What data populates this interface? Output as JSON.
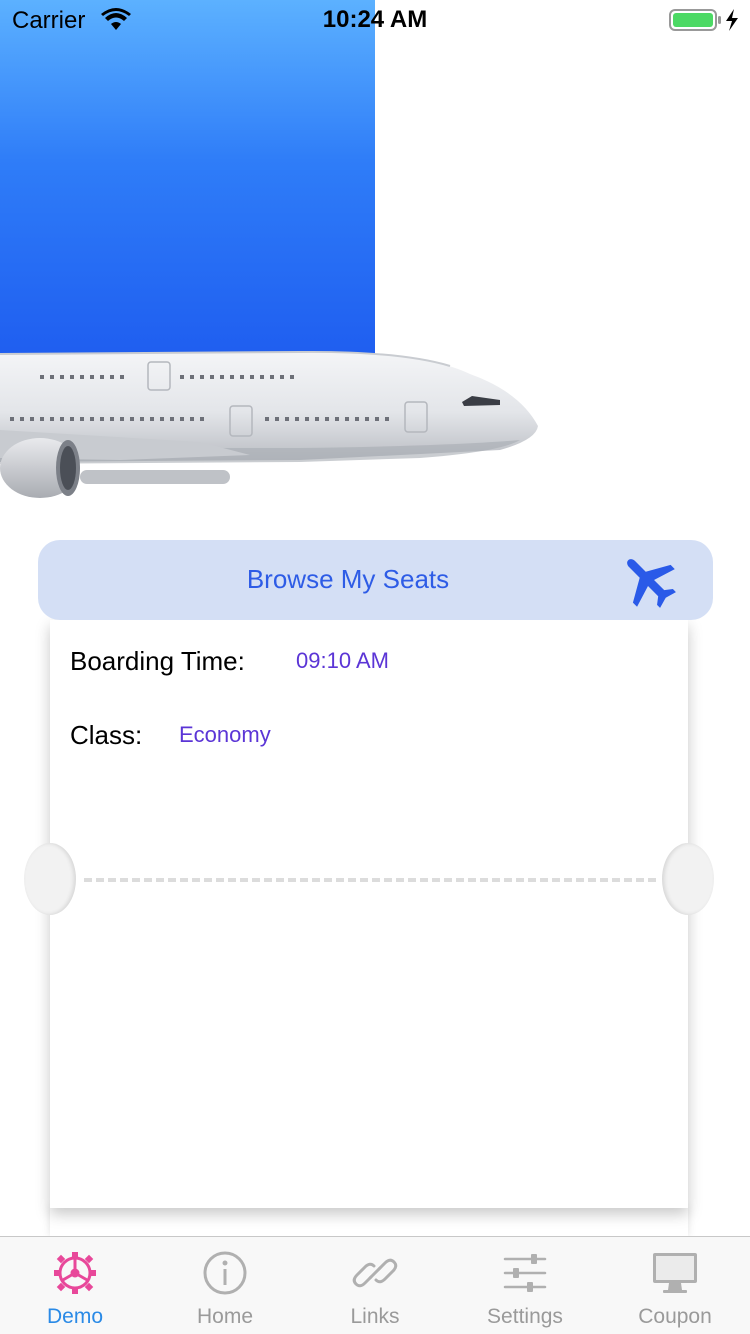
{
  "status_bar": {
    "carrier": "Carrier",
    "time": "10:24 AM",
    "battery_icon": "battery-charging-icon",
    "wifi_icon": "wifi-icon"
  },
  "hero": {
    "image": "airplane-photo"
  },
  "browse": {
    "label": "Browse My Seats",
    "icon": "airplane-icon",
    "accent": "#2e5ce6",
    "background": "#d4dff5"
  },
  "ticket": {
    "boarding_time_label": "Boarding Time:",
    "boarding_time_value": "09:10 AM",
    "class_label": "Class:",
    "class_value": "Economy",
    "value_color": "#5b35d6"
  },
  "tabs": [
    {
      "label": "Demo",
      "icon": "gear-icon",
      "active": true,
      "color": "#e8489a"
    },
    {
      "label": "Home",
      "icon": "info-icon",
      "active": false
    },
    {
      "label": "Links",
      "icon": "link-icon",
      "active": false
    },
    {
      "label": "Settings",
      "icon": "sliders-icon",
      "active": false
    },
    {
      "label": "Coupon",
      "icon": "monitor-icon",
      "active": false
    }
  ]
}
